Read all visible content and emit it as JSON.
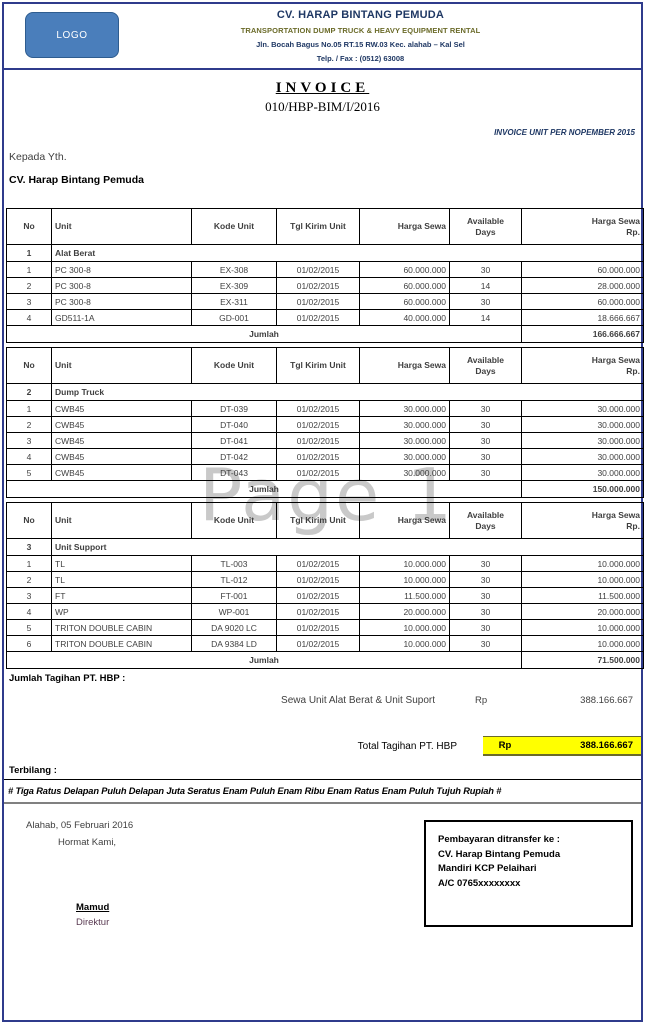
{
  "company": {
    "logo_label": "LOGO",
    "name": "CV. HARAP BINTANG PEMUDA",
    "business": "TRANSPORTATION DUMP TRUCK & HEAVY EQUIPMENT RENTAL",
    "address": "Jln. Bocah Bagus No.05 RT.15 RW.03 Kec. alahab – Kal Sel",
    "telephone": "Telp. / Fax : (0512) 63008"
  },
  "invoice": {
    "title": "INVOICE",
    "number": "010/HBP-BIM/I/2016",
    "period": "INVOICE UNIT PER NOPEMBER 2015",
    "recipient_label": "Kepada Yth.",
    "recipient_name": "CV. Harap Bintang Pemuda"
  },
  "columns": {
    "no": "No",
    "unit": "Unit",
    "kode_unit": "Kode Unit",
    "tgl_kirim": "Tgl Kirim Unit",
    "harga_sewa": "Harga Sewa",
    "available_days_line1": "Available",
    "available_days_line2": "Days",
    "harga_sewa_rp_line1": "Harga Sewa",
    "harga_sewa_rp_line2": "Rp.",
    "jumlah": "Jumlah"
  },
  "sections": [
    {
      "no": "1",
      "title": "Alat Berat",
      "rows": [
        {
          "no": "1",
          "unit": "PC 300-8",
          "kode": "EX-308",
          "tgl": "01/02/2015",
          "harga": "60.000.000",
          "days": "30",
          "total": "60.000.000"
        },
        {
          "no": "2",
          "unit": "PC 300-8",
          "kode": "EX-309",
          "tgl": "01/02/2015",
          "harga": "60.000.000",
          "days": "14",
          "total": "28.000.000"
        },
        {
          "no": "3",
          "unit": "PC 300-8",
          "kode": "EX-311",
          "tgl": "01/02/2015",
          "harga": "60.000.000",
          "days": "30",
          "total": "60.000.000"
        },
        {
          "no": "4",
          "unit": "GD511-1A",
          "kode": "GD-001",
          "tgl": "01/02/2015",
          "harga": "40.000.000",
          "days": "14",
          "total": "18.666.667"
        }
      ],
      "jumlah": "166.666.667"
    },
    {
      "no": "2",
      "title": "Dump Truck",
      "rows": [
        {
          "no": "1",
          "unit": "CWB45",
          "kode": "DT-039",
          "tgl": "01/02/2015",
          "harga": "30.000.000",
          "days": "30",
          "total": "30.000.000"
        },
        {
          "no": "2",
          "unit": "CWB45",
          "kode": "DT-040",
          "tgl": "01/02/2015",
          "harga": "30.000.000",
          "days": "30",
          "total": "30.000.000"
        },
        {
          "no": "3",
          "unit": "CWB45",
          "kode": "DT-041",
          "tgl": "01/02/2015",
          "harga": "30.000.000",
          "days": "30",
          "total": "30.000.000"
        },
        {
          "no": "4",
          "unit": "CWB45",
          "kode": "DT-042",
          "tgl": "01/02/2015",
          "harga": "30.000.000",
          "days": "30",
          "total": "30.000.000"
        },
        {
          "no": "5",
          "unit": "CWB45",
          "kode": "DT-043",
          "tgl": "01/02/2015",
          "harga": "30.000.000",
          "days": "30",
          "total": "30.000.000"
        }
      ],
      "jumlah": "150.000.000"
    },
    {
      "no": "3",
      "title": "Unit Support",
      "rows": [
        {
          "no": "1",
          "unit": "TL",
          "kode": "TL-003",
          "tgl": "01/02/2015",
          "harga": "10.000.000",
          "days": "30",
          "total": "10.000.000"
        },
        {
          "no": "2",
          "unit": "TL",
          "kode": "TL-012",
          "tgl": "01/02/2015",
          "harga": "10.000.000",
          "days": "30",
          "total": "10.000.000"
        },
        {
          "no": "3",
          "unit": "FT",
          "kode": "FT-001",
          "tgl": "01/02/2015",
          "harga": "11.500.000",
          "days": "30",
          "total": "11.500.000"
        },
        {
          "no": "4",
          "unit": "WP",
          "kode": "WP-001",
          "tgl": "01/02/2015",
          "harga": "20.000.000",
          "days": "30",
          "total": "20.000.000"
        },
        {
          "no": "5",
          "unit": "TRITON DOUBLE CABIN",
          "kode": "DA 9020 LC",
          "tgl": "01/02/2015",
          "harga": "10.000.000",
          "days": "30",
          "total": "10.000.000"
        },
        {
          "no": "6",
          "unit": "TRITON DOUBLE CABIN",
          "kode": "DA 9384 LD",
          "tgl": "01/02/2015",
          "harga": "10.000.000",
          "days": "30",
          "total": "10.000.000"
        }
      ],
      "jumlah": "71.500.000"
    }
  ],
  "totals": {
    "heading": "Jumlah Tagihan PT. HBP :",
    "subtotal_label": "Sewa Unit Alat Berat & Unit Suport",
    "subtotal_currency": "Rp",
    "subtotal_amount": "388.166.667",
    "grand_label": "Total Tagihan PT. HBP",
    "grand_currency": "Rp",
    "grand_amount": "388.166.667",
    "highlight_color": "#ffff00"
  },
  "terbilang": {
    "label": "Terbilang :",
    "text": "# Tiga Ratus Delapan Puluh Delapan Juta Seratus Enam Puluh Enam Ribu Enam Ratus Enam Puluh Tujuh Rupiah #"
  },
  "footer": {
    "place_date": "Alahab, 05 Februari 2016",
    "regards": "Hormat Kami,",
    "signer_name": "Mamud",
    "signer_role": "Direktur",
    "payment_box": [
      "Pembayaran ditransfer ke :",
      "CV. Harap Bintang Pemuda",
      "Mandiri KCP Pelaihari",
      "A/C 0765xxxxxxxx"
    ]
  },
  "watermark": "Page 1"
}
